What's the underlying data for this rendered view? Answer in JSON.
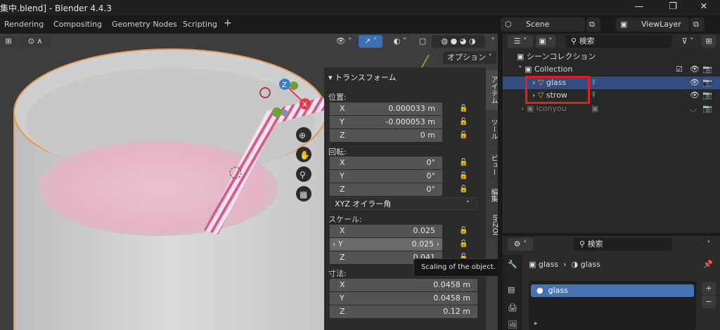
{
  "title_bar": {
    "title": "集中.blend] - Blender 4.4.3",
    "minimize": "—",
    "maximize": "❐",
    "close": "✕"
  },
  "workspaces": [
    "Rendering",
    "Compositing",
    "Geometry Nodes",
    "Scripting"
  ],
  "workspace_add": "+",
  "scene": {
    "label": "Scene",
    "view_layer": "ViewLayer"
  },
  "viewport": {
    "options_label": "オプション"
  },
  "npanel": {
    "header": "トランスフォーム",
    "location_label": "位置:",
    "location": [
      {
        "axis": "X",
        "value": "0.000033 m"
      },
      {
        "axis": "Y",
        "value": "-0.000053 m"
      },
      {
        "axis": "Z",
        "value": "0 m"
      }
    ],
    "rotation_label": "回転:",
    "rotation": [
      {
        "axis": "X",
        "value": "0°"
      },
      {
        "axis": "Y",
        "value": "0°"
      },
      {
        "axis": "Z",
        "value": "0°"
      }
    ],
    "rotation_mode": "XYZ オイラー角",
    "scale_label": "スケール:",
    "scale": [
      {
        "axis": "X",
        "value": "0.025"
      },
      {
        "axis": "Y",
        "value": "0.025"
      },
      {
        "axis": "Z",
        "value": "0.041"
      }
    ],
    "dimensions_label": "寸法:",
    "dimensions": [
      {
        "axis": "X",
        "value": "0.0458 m"
      },
      {
        "axis": "Y",
        "value": "0.0458 m"
      },
      {
        "axis": "Z",
        "value": "0.12 m"
      }
    ],
    "tabs": [
      "アイテム",
      "ツール",
      "ビュー",
      "編集",
      "imZOI"
    ]
  },
  "tooltip": "Scaling of the object.",
  "outliner": {
    "search_placeholder": "検索",
    "scene_collection": "シーンコレクション",
    "collection": "Collection",
    "objects": [
      "glass",
      "strow"
    ],
    "hidden_collection": "iconyou"
  },
  "properties": {
    "search_placeholder": "検索",
    "breadcrumb_object": "glass",
    "breadcrumb_material": "glass",
    "material_slot": "glass"
  }
}
